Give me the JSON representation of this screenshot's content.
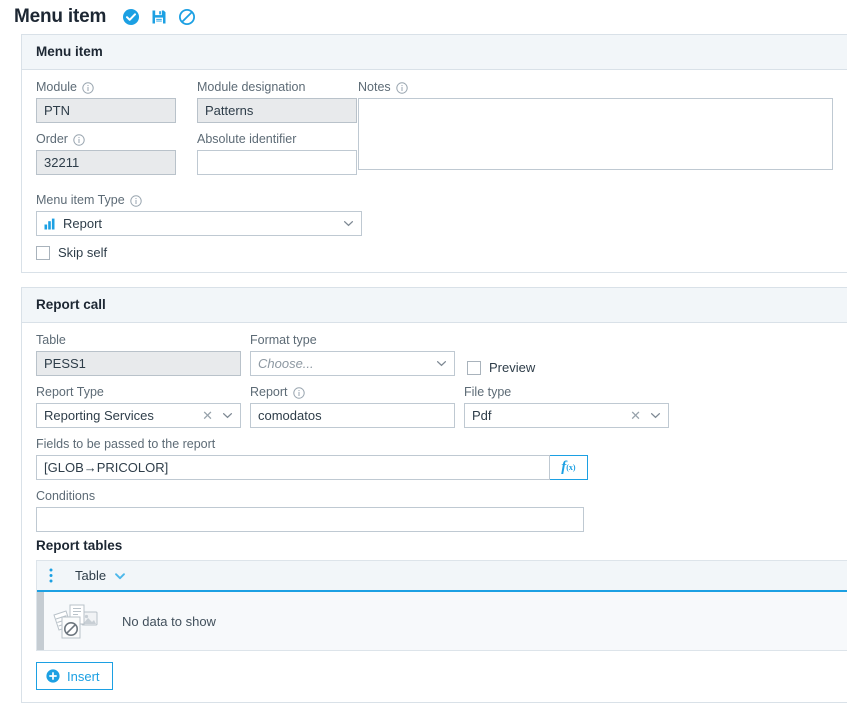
{
  "header": {
    "title": "Menu item",
    "actions": [
      {
        "name": "confirm-icon",
        "label": "Confirm"
      },
      {
        "name": "save-icon",
        "label": "Save"
      },
      {
        "name": "cancel-icon",
        "label": "Cancel"
      }
    ]
  },
  "colors": {
    "accent": "#1ca0e3",
    "panel_header_bg": "#f2f6f9",
    "border": "#d9e1e8",
    "label_text": "#5d6b76",
    "readonly_bg": "#e8eaec",
    "empty_row_bg": "#f7f9fb"
  },
  "menu_item_section": {
    "title": "Menu item",
    "module": {
      "label": "Module",
      "value": "PTN",
      "readonly": true,
      "has_info": true
    },
    "module_designation": {
      "label": "Module designation",
      "value": "Patterns",
      "readonly": true,
      "has_info": false
    },
    "notes": {
      "label": "Notes",
      "value": "",
      "has_info": true
    },
    "order": {
      "label": "Order",
      "value": "32211",
      "readonly": true,
      "has_info": true
    },
    "absolute_identifier": {
      "label": "Absolute identifier",
      "value": "",
      "readonly": false,
      "has_info": false
    },
    "menu_item_type": {
      "label": "Menu item Type",
      "value": "Report",
      "icon": "bar-chart-icon",
      "has_info": true
    },
    "skip_self": {
      "label": "Skip self",
      "checked": false
    }
  },
  "report_call_section": {
    "title": "Report call",
    "table": {
      "label": "Table",
      "value": "PESS1",
      "readonly": true
    },
    "format_type": {
      "label": "Format type",
      "value": "",
      "placeholder": "Choose..."
    },
    "preview": {
      "label": "Preview",
      "checked": false
    },
    "report_type": {
      "label": "Report Type",
      "value": "Reporting Services",
      "clearable": true
    },
    "report": {
      "label": "Report",
      "value": "comodatos",
      "has_info": true
    },
    "file_type": {
      "label": "File type",
      "value": "Pdf",
      "clearable": true
    },
    "fields_to_pass": {
      "label": "Fields to be passed to the report",
      "value": "[GLOB→PRICOLOR]",
      "fx_label": "f"
    },
    "conditions": {
      "label": "Conditions",
      "value": ""
    },
    "report_tables": {
      "title": "Report tables",
      "columns": [
        "Table"
      ],
      "rows": [],
      "empty_text": "No data to show",
      "insert_label": "Insert"
    }
  }
}
